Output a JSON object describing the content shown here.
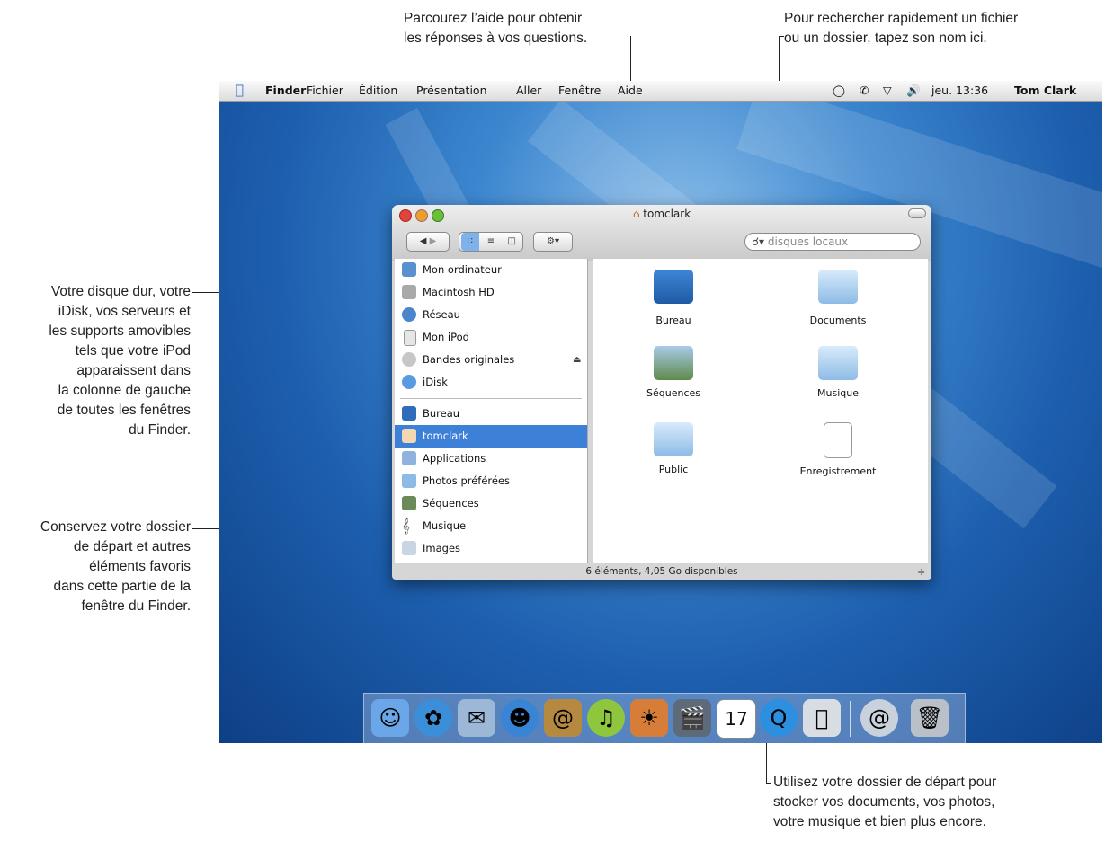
{
  "callouts": {
    "top_center": [
      "Parcourez l’aide pour obtenir",
      "les réponses à vos questions."
    ],
    "top_right": [
      "Pour rechercher rapidement un fichier",
      "ou un dossier, tapez son nom ici."
    ],
    "left_1": [
      "Votre disque dur, votre",
      "iDisk, vos serveurs et",
      "les supports amovibles",
      "tels que votre iPod",
      "apparaissent dans",
      "la colonne de gauche",
      "de toutes les fenêtres",
      "du Finder."
    ],
    "left_2": [
      "Conservez votre dossier",
      "de départ et autres",
      "éléments favoris",
      "dans cette partie de la",
      "fenêtre du Finder."
    ],
    "bottom_right": [
      "Utilisez votre dossier de départ pour",
      "stocker vos documents, vos photos,",
      "votre musique et bien plus encore."
    ]
  },
  "menubar": {
    "items": [
      "Finder",
      "Fichier",
      "Édition",
      "Présentation",
      "Aller",
      "Fenêtre",
      "Aide"
    ],
    "clock": "jeu. 13:36",
    "user": "Tom Clark"
  },
  "finder": {
    "title": "tomclark",
    "search_placeholder": "disques locaux",
    "devices": [
      "Mon ordinateur",
      "Macintosh HD",
      "Réseau",
      "Mon iPod",
      "Bandes originales",
      "iDisk"
    ],
    "places": [
      "Bureau",
      "tomclark",
      "Applications",
      "Photos préférées",
      "Séquences",
      "Musique",
      "Images"
    ],
    "selected_place": "tomclark",
    "items": [
      "Bureau",
      "Documents",
      "Séquences",
      "Musique",
      "Public",
      "Enregistrement"
    ],
    "status": "6 éléments, 4,05 Go disponibles",
    "calendar_day": "17"
  },
  "colors": {
    "selection": "#3d80d8",
    "desktop": "#1d5fae"
  }
}
